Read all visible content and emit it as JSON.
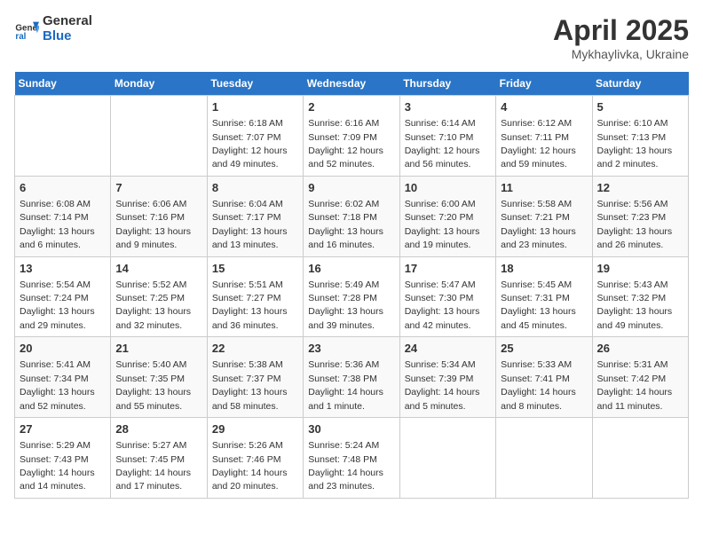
{
  "header": {
    "logo_general": "General",
    "logo_blue": "Blue",
    "title": "April 2025",
    "subtitle": "Mykhaylivka, Ukraine"
  },
  "days_of_week": [
    "Sunday",
    "Monday",
    "Tuesday",
    "Wednesday",
    "Thursday",
    "Friday",
    "Saturday"
  ],
  "weeks": [
    [
      {
        "day": "",
        "info": ""
      },
      {
        "day": "",
        "info": ""
      },
      {
        "day": "1",
        "info": "Sunrise: 6:18 AM\nSunset: 7:07 PM\nDaylight: 12 hours and 49 minutes."
      },
      {
        "day": "2",
        "info": "Sunrise: 6:16 AM\nSunset: 7:09 PM\nDaylight: 12 hours and 52 minutes."
      },
      {
        "day": "3",
        "info": "Sunrise: 6:14 AM\nSunset: 7:10 PM\nDaylight: 12 hours and 56 minutes."
      },
      {
        "day": "4",
        "info": "Sunrise: 6:12 AM\nSunset: 7:11 PM\nDaylight: 12 hours and 59 minutes."
      },
      {
        "day": "5",
        "info": "Sunrise: 6:10 AM\nSunset: 7:13 PM\nDaylight: 13 hours and 2 minutes."
      }
    ],
    [
      {
        "day": "6",
        "info": "Sunrise: 6:08 AM\nSunset: 7:14 PM\nDaylight: 13 hours and 6 minutes."
      },
      {
        "day": "7",
        "info": "Sunrise: 6:06 AM\nSunset: 7:16 PM\nDaylight: 13 hours and 9 minutes."
      },
      {
        "day": "8",
        "info": "Sunrise: 6:04 AM\nSunset: 7:17 PM\nDaylight: 13 hours and 13 minutes."
      },
      {
        "day": "9",
        "info": "Sunrise: 6:02 AM\nSunset: 7:18 PM\nDaylight: 13 hours and 16 minutes."
      },
      {
        "day": "10",
        "info": "Sunrise: 6:00 AM\nSunset: 7:20 PM\nDaylight: 13 hours and 19 minutes."
      },
      {
        "day": "11",
        "info": "Sunrise: 5:58 AM\nSunset: 7:21 PM\nDaylight: 13 hours and 23 minutes."
      },
      {
        "day": "12",
        "info": "Sunrise: 5:56 AM\nSunset: 7:23 PM\nDaylight: 13 hours and 26 minutes."
      }
    ],
    [
      {
        "day": "13",
        "info": "Sunrise: 5:54 AM\nSunset: 7:24 PM\nDaylight: 13 hours and 29 minutes."
      },
      {
        "day": "14",
        "info": "Sunrise: 5:52 AM\nSunset: 7:25 PM\nDaylight: 13 hours and 32 minutes."
      },
      {
        "day": "15",
        "info": "Sunrise: 5:51 AM\nSunset: 7:27 PM\nDaylight: 13 hours and 36 minutes."
      },
      {
        "day": "16",
        "info": "Sunrise: 5:49 AM\nSunset: 7:28 PM\nDaylight: 13 hours and 39 minutes."
      },
      {
        "day": "17",
        "info": "Sunrise: 5:47 AM\nSunset: 7:30 PM\nDaylight: 13 hours and 42 minutes."
      },
      {
        "day": "18",
        "info": "Sunrise: 5:45 AM\nSunset: 7:31 PM\nDaylight: 13 hours and 45 minutes."
      },
      {
        "day": "19",
        "info": "Sunrise: 5:43 AM\nSunset: 7:32 PM\nDaylight: 13 hours and 49 minutes."
      }
    ],
    [
      {
        "day": "20",
        "info": "Sunrise: 5:41 AM\nSunset: 7:34 PM\nDaylight: 13 hours and 52 minutes."
      },
      {
        "day": "21",
        "info": "Sunrise: 5:40 AM\nSunset: 7:35 PM\nDaylight: 13 hours and 55 minutes."
      },
      {
        "day": "22",
        "info": "Sunrise: 5:38 AM\nSunset: 7:37 PM\nDaylight: 13 hours and 58 minutes."
      },
      {
        "day": "23",
        "info": "Sunrise: 5:36 AM\nSunset: 7:38 PM\nDaylight: 14 hours and 1 minute."
      },
      {
        "day": "24",
        "info": "Sunrise: 5:34 AM\nSunset: 7:39 PM\nDaylight: 14 hours and 5 minutes."
      },
      {
        "day": "25",
        "info": "Sunrise: 5:33 AM\nSunset: 7:41 PM\nDaylight: 14 hours and 8 minutes."
      },
      {
        "day": "26",
        "info": "Sunrise: 5:31 AM\nSunset: 7:42 PM\nDaylight: 14 hours and 11 minutes."
      }
    ],
    [
      {
        "day": "27",
        "info": "Sunrise: 5:29 AM\nSunset: 7:43 PM\nDaylight: 14 hours and 14 minutes."
      },
      {
        "day": "28",
        "info": "Sunrise: 5:27 AM\nSunset: 7:45 PM\nDaylight: 14 hours and 17 minutes."
      },
      {
        "day": "29",
        "info": "Sunrise: 5:26 AM\nSunset: 7:46 PM\nDaylight: 14 hours and 20 minutes."
      },
      {
        "day": "30",
        "info": "Sunrise: 5:24 AM\nSunset: 7:48 PM\nDaylight: 14 hours and 23 minutes."
      },
      {
        "day": "",
        "info": ""
      },
      {
        "day": "",
        "info": ""
      },
      {
        "day": "",
        "info": ""
      }
    ]
  ]
}
